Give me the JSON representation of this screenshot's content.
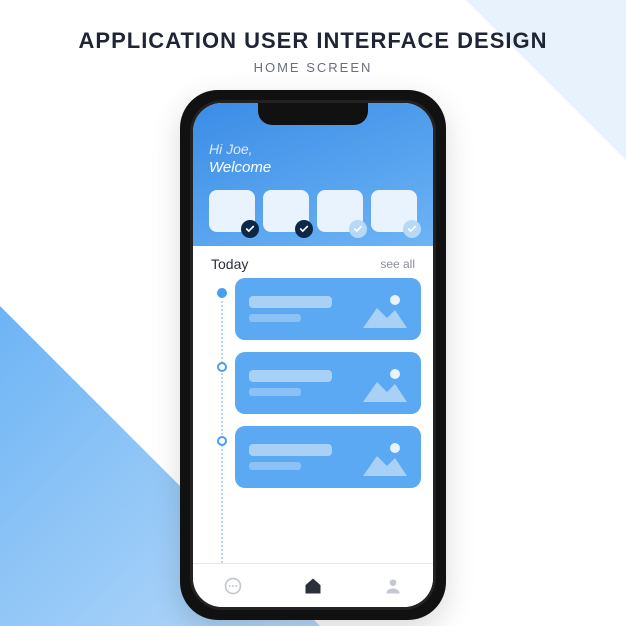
{
  "page": {
    "title": "APPLICATION USER INTERFACE DESIGN",
    "subtitle": "HOME SCREEN"
  },
  "header": {
    "greeting_line1": "Hi Joe,",
    "greeting_line2": "Welcome"
  },
  "tiles": [
    {
      "checked": true
    },
    {
      "checked": true
    },
    {
      "checked": false
    },
    {
      "checked": false
    }
  ],
  "section": {
    "title": "Today",
    "see_all": "see all"
  },
  "timeline": {
    "items": [
      {
        "current": true
      },
      {
        "current": false
      },
      {
        "current": false
      }
    ]
  },
  "nav": {
    "icons": [
      "chat-icon",
      "home-icon",
      "profile-icon"
    ],
    "active": "home-icon"
  },
  "colors": {
    "accent": "#5aa9f2",
    "dark": "#0d2847"
  }
}
